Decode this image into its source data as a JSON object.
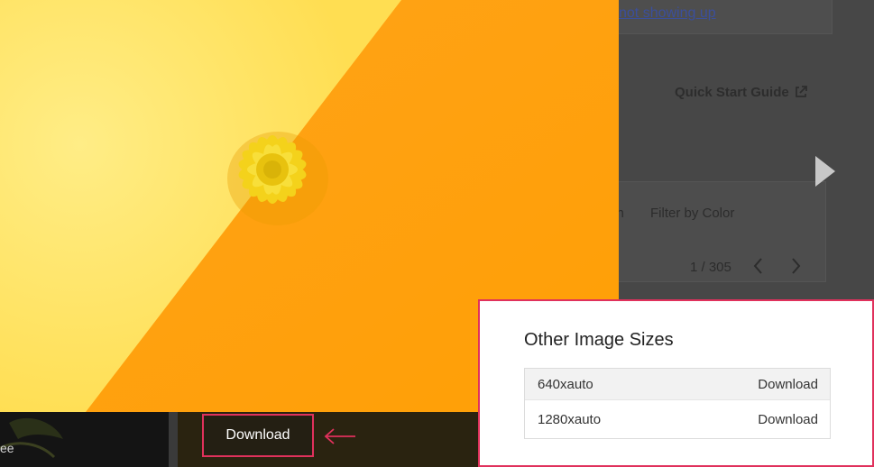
{
  "background_page": {
    "link_text": "not showing up",
    "quick_start_label": "Quick Start Guide",
    "external_link_icon": "external-link-icon",
    "tabs": [
      "Search",
      "Filter by Color"
    ],
    "visible_tab_fragment": "ch",
    "pagination": "1 / 305",
    "prev_icon": "chevron-left-icon",
    "next_icon": "chevron-right-icon",
    "next_image_icon": "play-arrow-icon"
  },
  "photo": {
    "subject": "yellow flower on yellow and orange background",
    "colors": {
      "light_yellow": "#ffe66e",
      "orange": "#ffa400",
      "flower": "#f7d51a"
    }
  },
  "bottom_bar": {
    "thumb_caption": "ee",
    "download_label": "Download",
    "arrow_icon": "left-arrow-icon",
    "highlight_color": "#e0315c"
  },
  "popup": {
    "title": "Other Image Sizes",
    "sizes": [
      {
        "label": "640xauto",
        "action": "Download"
      },
      {
        "label": "1280xauto",
        "action": "Download"
      }
    ]
  }
}
